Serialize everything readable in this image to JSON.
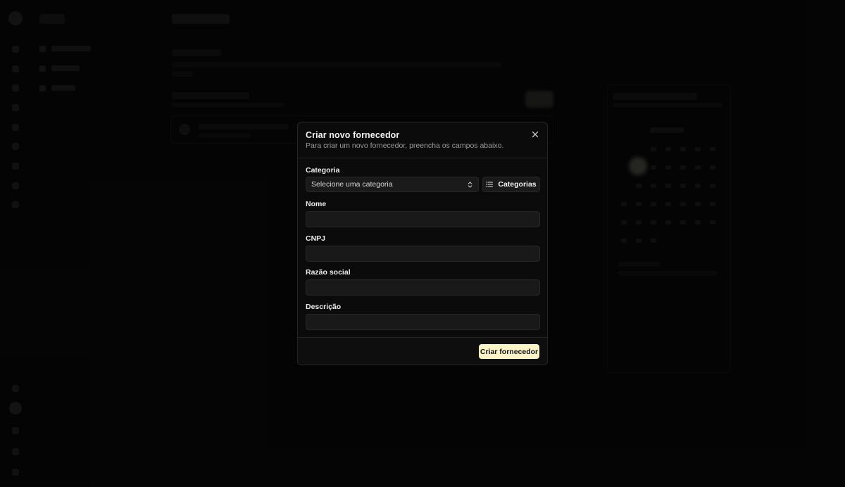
{
  "dialog": {
    "title": "Criar novo fornecedor",
    "description": "Para criar um novo fornecedor, preencha os campos abaixo.",
    "close_icon": "x-icon",
    "fields": {
      "categoria": {
        "label": "Categoria",
        "select_value": "Selecione uma categoria",
        "select_icon": "chevrons-up-down-icon",
        "button_label": "Categorias",
        "button_icon": "list-icon"
      },
      "nome": {
        "label": "Nome",
        "value": ""
      },
      "cnpj": {
        "label": "CNPJ",
        "value": ""
      },
      "razao_social": {
        "label": "Razão social",
        "value": ""
      },
      "descricao": {
        "label": "Descrição",
        "value": ""
      }
    },
    "submit_label": "Criar fornecedor"
  },
  "colors": {
    "primary_button": "#faf3c6",
    "dialog_background": "#0b0b0b",
    "input_background": "#191919",
    "page_background": "#070707"
  }
}
